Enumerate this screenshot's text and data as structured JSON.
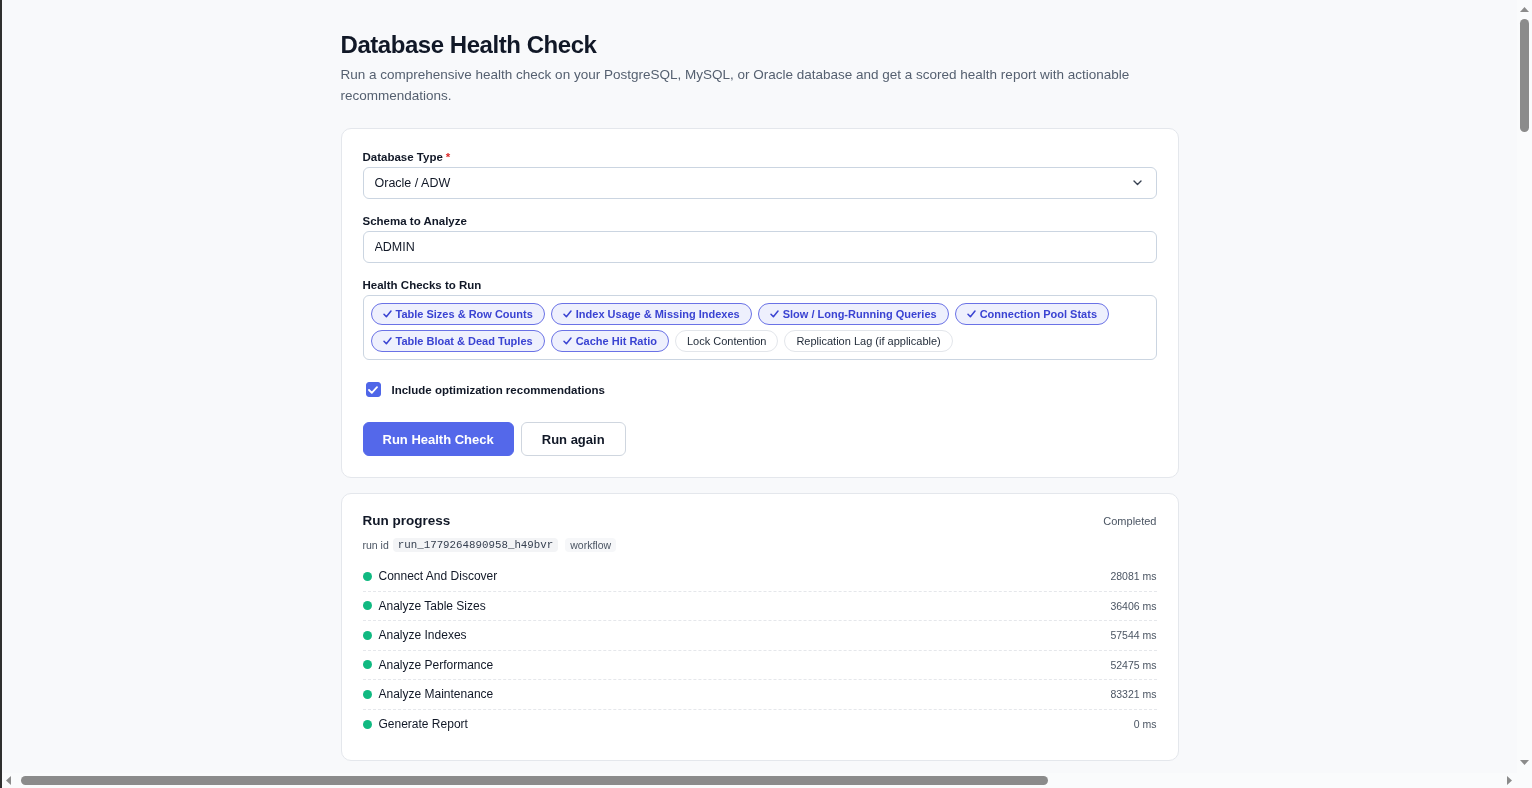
{
  "page": {
    "title": "Database Health Check",
    "description": "Run a comprehensive health check on your PostgreSQL, MySQL, or Oracle database and get a scored health report with actionable recommendations."
  },
  "form": {
    "database_type": {
      "label": "Database Type",
      "required_mark": "*",
      "value": "Oracle / ADW"
    },
    "schema": {
      "label": "Schema to Analyze",
      "value": "ADMIN"
    },
    "health_checks": {
      "label": "Health Checks to Run",
      "options": [
        {
          "label": "Table Sizes & Row Counts",
          "selected": true
        },
        {
          "label": "Index Usage & Missing Indexes",
          "selected": true
        },
        {
          "label": "Slow / Long-Running Queries",
          "selected": true
        },
        {
          "label": "Connection Pool Stats",
          "selected": true
        },
        {
          "label": "Table Bloat & Dead Tuples",
          "selected": true
        },
        {
          "label": "Cache Hit Ratio",
          "selected": true
        },
        {
          "label": "Lock Contention",
          "selected": false
        },
        {
          "label": "Replication Lag (if applicable)",
          "selected": false
        }
      ]
    },
    "include_recommendations": {
      "label": "Include optimization recommendations",
      "checked": true
    },
    "buttons": [
      {
        "label": "Run Health Check",
        "kind": "primary"
      },
      {
        "label": "Run again",
        "kind": "secondary"
      }
    ]
  },
  "run_progress": {
    "title": "Run progress",
    "status": "Completed",
    "run_id_label": "run id",
    "run_id": "run_1779264890958_h49bvr",
    "tag": "workflow",
    "steps": [
      {
        "name": "Connect And Discover",
        "duration": "28081 ms",
        "completed": true
      },
      {
        "name": "Analyze Table Sizes",
        "duration": "36406 ms",
        "completed": true
      },
      {
        "name": "Analyze Indexes",
        "duration": "57544 ms",
        "completed": true
      },
      {
        "name": "Analyze Performance",
        "duration": "52475 ms",
        "completed": true
      },
      {
        "name": "Analyze Maintenance",
        "duration": "83321 ms",
        "completed": true
      },
      {
        "name": "Generate Report",
        "duration": "0 ms",
        "completed": true
      }
    ]
  }
}
